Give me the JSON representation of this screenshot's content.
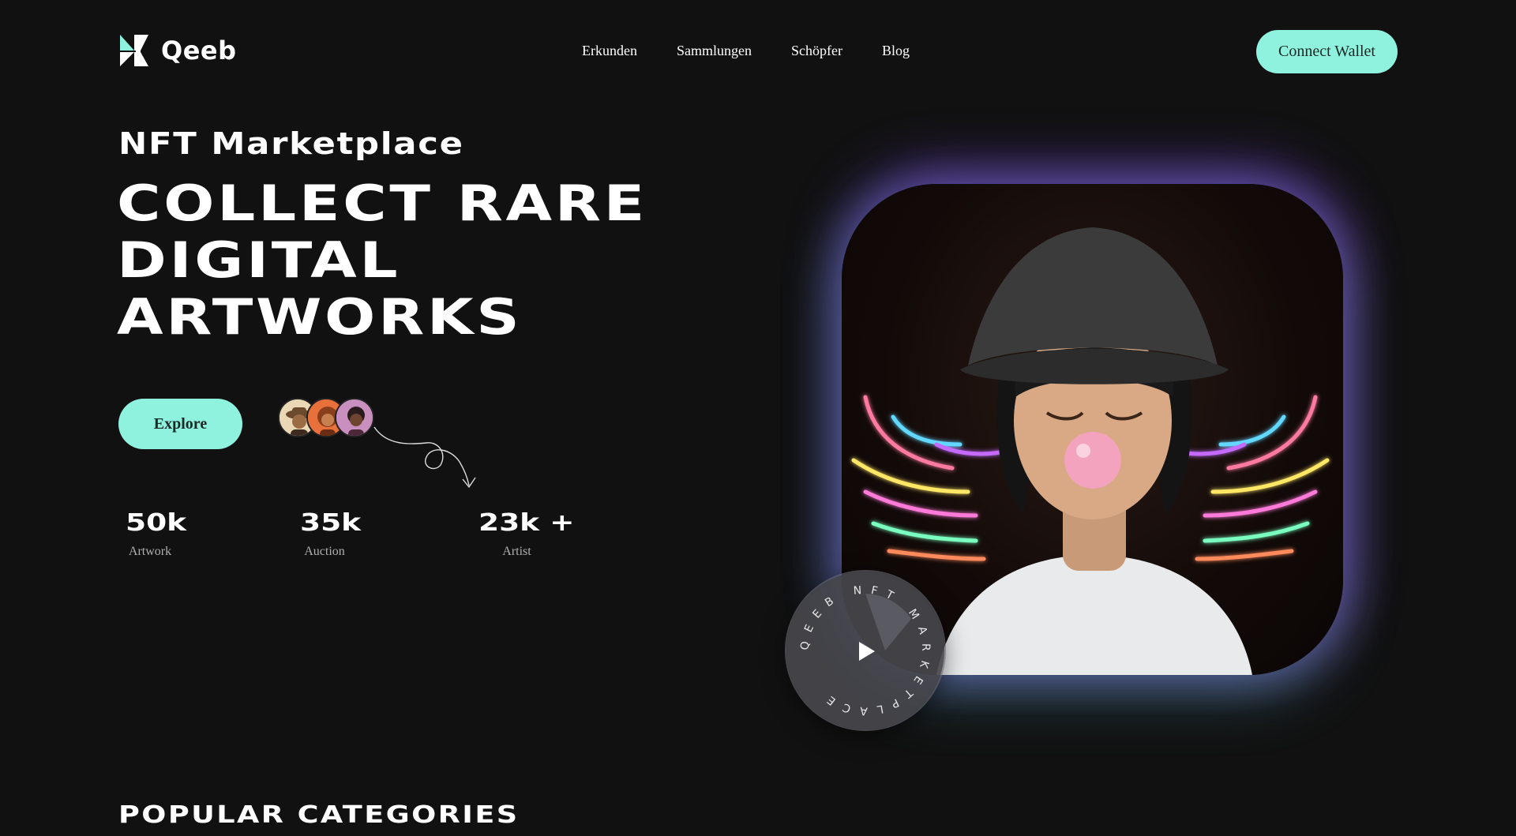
{
  "header": {
    "brand": "Qeeb",
    "nav": [
      "Erkunden",
      "Sammlungen",
      "Schöpfer",
      "Blog"
    ],
    "connect_label": "Connect Wallet"
  },
  "hero": {
    "subtitle": "NFT Marketplace",
    "headline": [
      "COLLECT RARE",
      "DIGITAL",
      "ARTWORKS"
    ],
    "explore_label": "Explore",
    "stats": [
      {
        "value": "50k",
        "label": "Artwork"
      },
      {
        "value": "35k",
        "label": "Auction"
      },
      {
        "value": "23k +",
        "label": "Artist"
      }
    ],
    "badge_text": "QEEB NFT MARKETPLACE"
  },
  "sections": {
    "popular_title": "POPULAR CATEGORIES"
  },
  "colors": {
    "accent": "#8ff2de",
    "background": "#111111"
  },
  "icons": {
    "logo": "hexagon-logo-icon",
    "play": "play-icon",
    "arrow": "curly-arrow-icon"
  }
}
